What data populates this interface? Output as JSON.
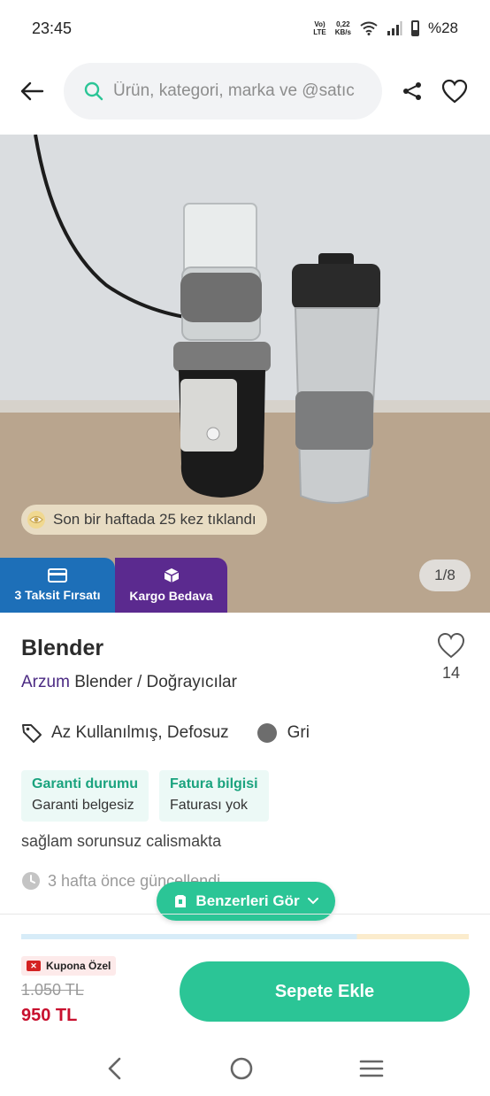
{
  "status_bar": {
    "time": "23:45",
    "network_top": "Vo)",
    "network_bottom": "LTE",
    "speed_value": "0,22",
    "speed_unit": "KB/s",
    "battery": "%28"
  },
  "header": {
    "search_placeholder": "Ürün, kategori, marka ve @satıc"
  },
  "gallery": {
    "view_notice": "Son bir haftada 25 kez tıklandı",
    "counter": "1/8",
    "badges": [
      {
        "label": "3 Taksit Fırsatı",
        "color": "#1d6fb8"
      },
      {
        "label": "Kargo Bedava",
        "color": "#5b2a8f"
      }
    ]
  },
  "product": {
    "title": "Blender",
    "favorite_count": "14",
    "brand": "Arzum",
    "category": "Blender / Doğrayıcılar",
    "condition": "Az Kullanılmış, Defosuz",
    "color_name": "Gri",
    "info_cards": [
      {
        "label": "Garanti durumu",
        "value": "Garanti belgesiz"
      },
      {
        "label": "Fatura bilgisi",
        "value": "Faturası yok"
      }
    ],
    "description": "sağlam sorunsuz calismakta",
    "updated": "3 hafta önce güncellendi"
  },
  "similar_button": "Benzerleri Gör",
  "purchase": {
    "coupon_label": "Kupona Özel",
    "old_price": "1.050 TL",
    "new_price": "950 TL",
    "add_to_cart": "Sepete Ekle"
  },
  "colors": {
    "accent_green": "#2bc596",
    "brand_purple": "#4b2a83",
    "price_red": "#c8102e"
  }
}
